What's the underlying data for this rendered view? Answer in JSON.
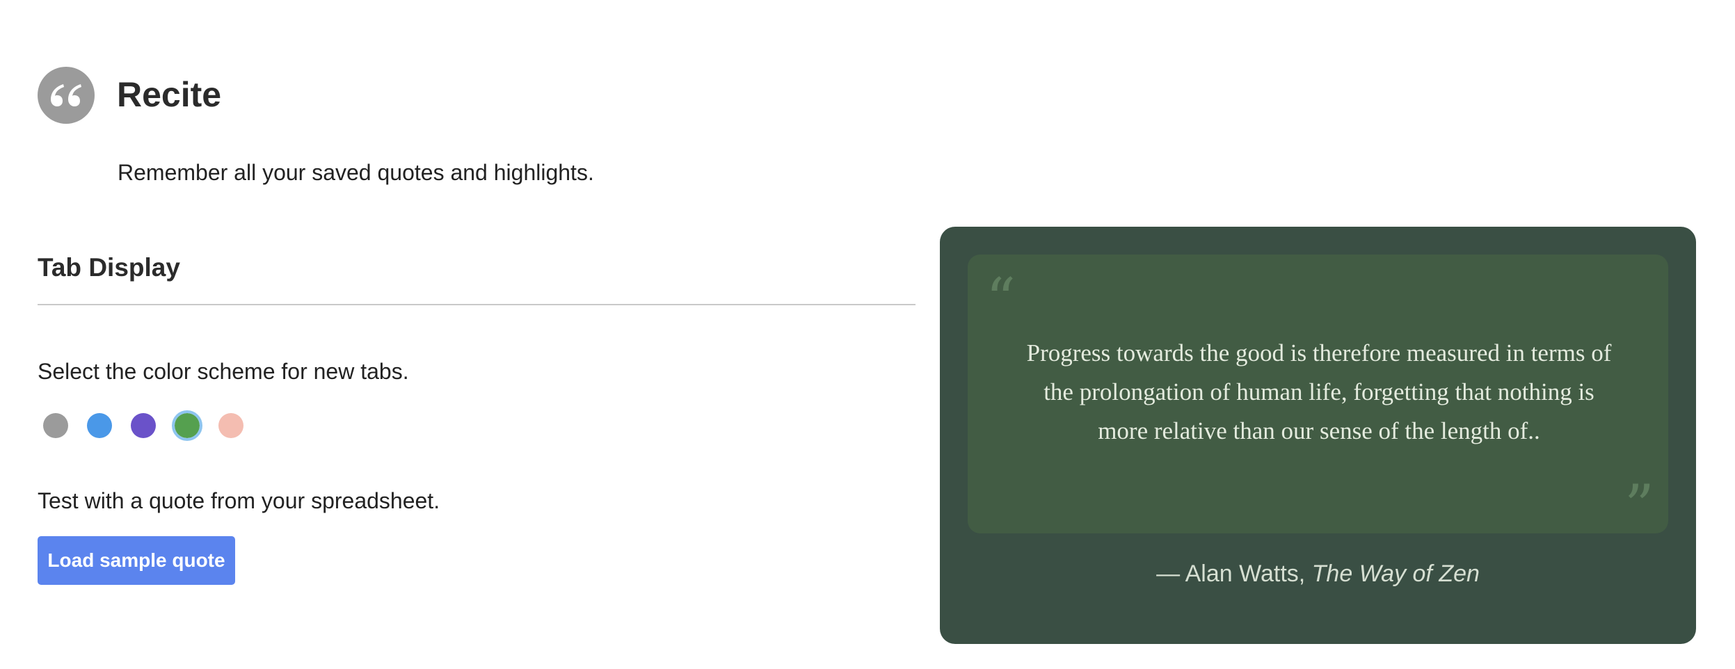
{
  "app": {
    "logo_icon": "quote-marks-icon",
    "title": "Recite",
    "subtitle": "Remember all your saved quotes and highlights."
  },
  "settings": {
    "section_title": "Tab Display",
    "color_scheme_label": "Select the color scheme for new tabs.",
    "selected_scheme": "green",
    "color_schemes": [
      {
        "name": "gray",
        "color": "#9b9b9b"
      },
      {
        "name": "blue",
        "color": "#4a98e8"
      },
      {
        "name": "purple",
        "color": "#6a52c9"
      },
      {
        "name": "green",
        "color": "#55a04f"
      },
      {
        "name": "pink",
        "color": "#f4bdb1"
      }
    ],
    "test_label": "Test with a quote from your spreadsheet.",
    "load_button_label": "Load sample quote"
  },
  "preview": {
    "card_color": "#3a4f44",
    "quote_box_color": "#425c44",
    "open_quote_mark": "“",
    "close_quote_mark": "”",
    "quote": "Progress towards the good is therefore measured in terms of the prolongation of human life, forgetting that nothing is more relative than our sense of the length of..",
    "author": "— Alan Watts, ",
    "book": "The Way of Zen"
  }
}
